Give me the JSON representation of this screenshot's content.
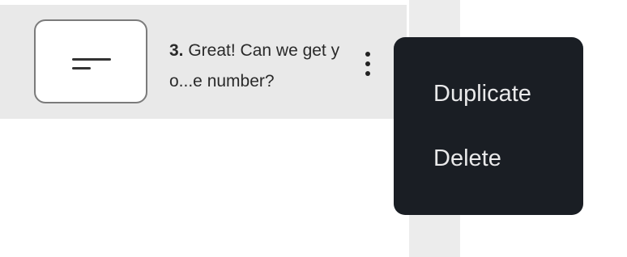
{
  "question_row": {
    "number": "3.",
    "text": " Great! Can we get yo...e number?",
    "thumbnail_icon": "short-text-icon"
  },
  "more_options_icon": "kebab-vertical-icon",
  "context_menu": {
    "items": [
      {
        "label": "Duplicate"
      },
      {
        "label": "Delete"
      }
    ]
  },
  "colors": {
    "row_background": "#e9e9e9",
    "menu_background": "#1a1e24",
    "menu_text": "#e9e9ea",
    "side_column": "#ececec"
  }
}
